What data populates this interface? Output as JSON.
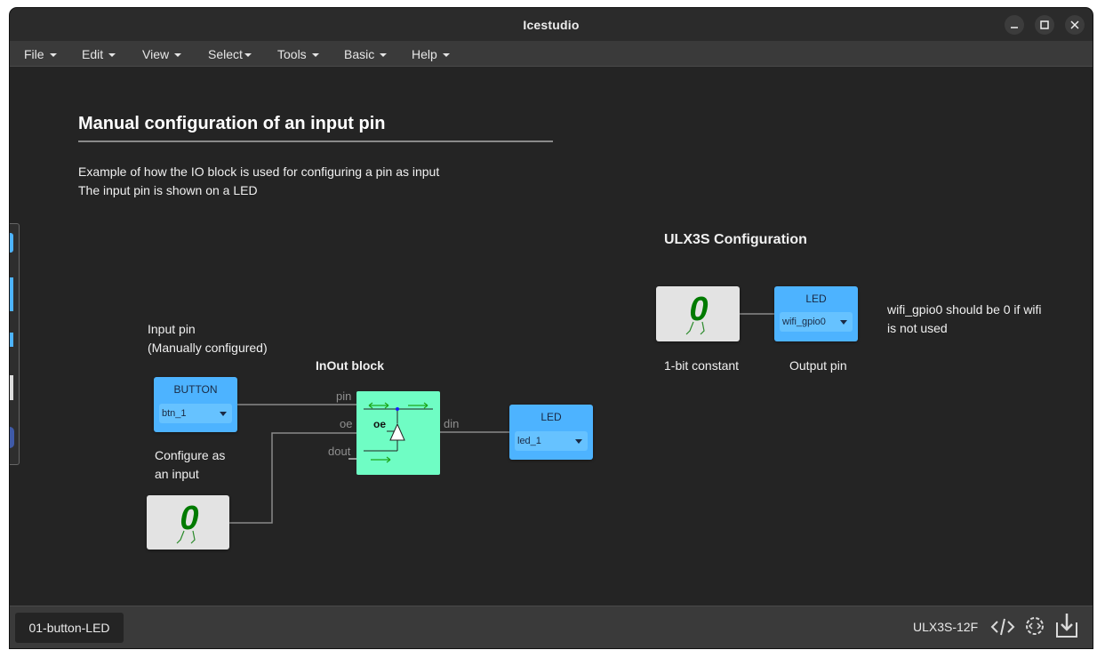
{
  "window": {
    "title": "Icestudio"
  },
  "menu": [
    {
      "label": "File"
    },
    {
      "label": "Edit"
    },
    {
      "label": "View"
    },
    {
      "label": "Select"
    },
    {
      "label": "Tools"
    },
    {
      "label": "Basic"
    },
    {
      "label": "Help"
    }
  ],
  "canvas": {
    "heading": "Manual configuration of an input pin",
    "desc_line1": "Example of how the IO block is used for configuring a pin as input",
    "desc_line2": "The input pin is shown on a LED",
    "ulx3s_heading": "ULX3S Configuration",
    "input_pin_line1": "Input pin",
    "input_pin_line2": "(Manually configured)",
    "inout_label": "InOut block",
    "configure_line1": "Configure as",
    "configure_line2": "an input",
    "wifi_note_line1": "wifi_gpio0 should be 0 if wifi",
    "wifi_note_line2": "is not used",
    "const_caption": "1-bit constant",
    "output_caption": "Output pin",
    "button_block": {
      "name": "BUTTON",
      "value": "btn_1"
    },
    "led_block": {
      "name": "LED",
      "value": "led_1"
    },
    "wifi_block": {
      "name": "LED",
      "value": "wifi_gpio0"
    },
    "const_value": "0",
    "ports": {
      "pin": "pin",
      "oe": "oe",
      "dout": "dout",
      "din": "din",
      "inner_oe": "oe"
    }
  },
  "statusbar": {
    "tab_label": "01-button-LED",
    "board": "ULX3S-12F",
    "icons": [
      "code-icon",
      "settings-icon",
      "download-icon"
    ]
  },
  "colors": {
    "io_block": "#4db3ff",
    "inout_block": "#6ffdc4",
    "constant_digit": "#007a00"
  }
}
